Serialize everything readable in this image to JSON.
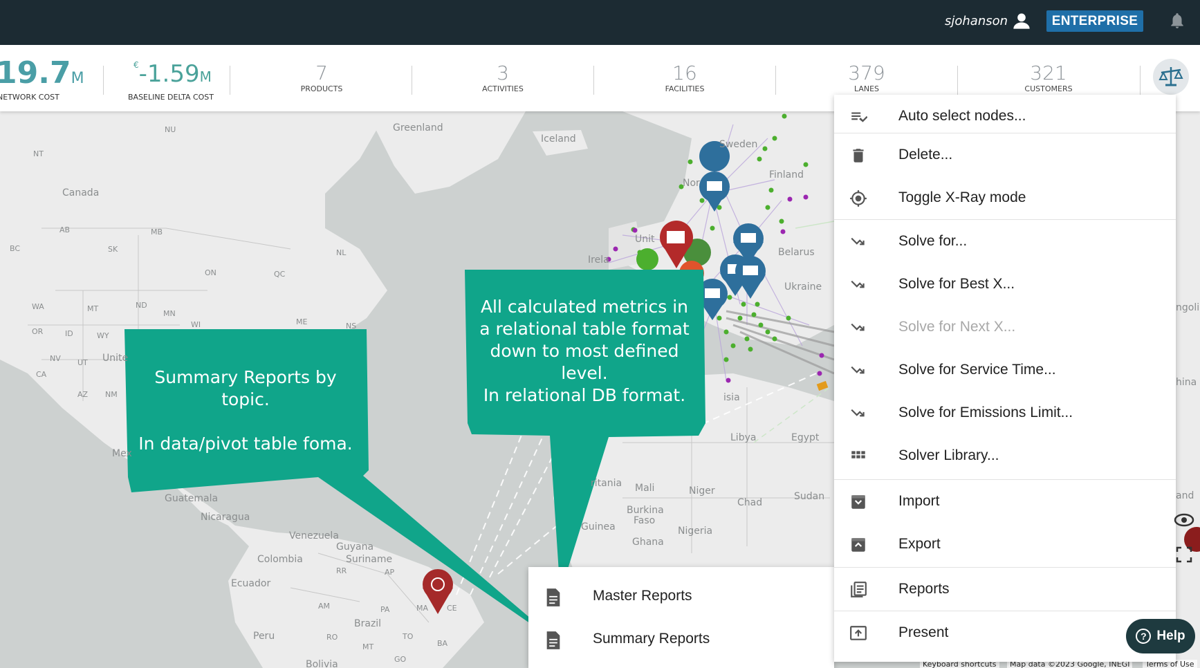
{
  "header": {
    "username": "sjohanson",
    "plan_badge": "ENTERPRISE"
  },
  "kpis": {
    "network_cost": {
      "value": "19.7",
      "unit": "M",
      "label": "NETWORK COST"
    },
    "baseline_delta": {
      "currency": "€",
      "value": "-1.59",
      "unit": "M",
      "label": "BASELINE DELTA COST"
    },
    "items": [
      {
        "value": "7",
        "label": "PRODUCTS"
      },
      {
        "value": "3",
        "label": "ACTIVITIES"
      },
      {
        "value": "16",
        "label": "FACILITIES"
      },
      {
        "value": "379",
        "label": "LANES"
      },
      {
        "value": "321",
        "label": "CUSTOMERS"
      }
    ]
  },
  "map": {
    "labels": {
      "greenland": "Greenland",
      "iceland": "Iceland",
      "sweden": "Sweden",
      "canada": "Canada",
      "nu": "NU",
      "nt": "NT",
      "ab": "AB",
      "mb": "MB",
      "bc": "BC",
      "sk": "SK",
      "nl": "NL",
      "on": "ON",
      "qc": "QC",
      "wa": "WA",
      "mt": "MT",
      "nd": "ND",
      "mn": "MN",
      "or": "OR",
      "id": "ID",
      "wy": "WY",
      "nv": "NV",
      "ut": "UT",
      "ca": "CA",
      "az": "AZ",
      "nm": "NM",
      "united": "Unite",
      "mex": "Mex",
      "guatemala": "Guatemala",
      "nicaragua": "Nicaragua",
      "venezuela": "Venezuela",
      "guyana": "Guyana",
      "suriname": "Suriname",
      "colombia": "Colombia",
      "ecuador": "Ecuador",
      "brazil": "Brazil",
      "peru": "Peru",
      "bolivia": "Bolivia",
      "am": "AM",
      "pa": "PA",
      "ma": "MA",
      "ro": "RO",
      "to": "TO",
      "ba": "BA",
      "mt2": "MT",
      "go": "GO",
      "ce": "CE",
      "rr": "RR",
      "ap": "AP",
      "libya": "Libya",
      "egypt": "Egypt",
      "mali": "Mali",
      "niger": "Niger",
      "chad": "Chad",
      "sudan": "Sudan",
      "burkina": "Burkina",
      "faso": "Faso",
      "nigeria": "Nigeria",
      "ghana": "Ghana",
      "guinea": "Guinea",
      "mauritania": "ritania",
      "belarus": "Belarus",
      "ukraine": "Ukraine",
      "finland": "Finland",
      "ireland": "Irela",
      "unit": "Unit",
      "isia": "isia",
      "ngolia": "ngolia",
      "hina": "hina",
      "and": "and",
      "nor": "Nor",
      "me": "ME",
      "ns": "NS",
      "wi": "WI"
    },
    "footer": {
      "shortcuts": "Keyboard shortcuts",
      "data": "Map data ©2023 Google, INEGI",
      "terms": "Terms of Use"
    }
  },
  "callouts": {
    "summary": "Summary Reports by\ntopic.\n\nIn data/pivot table foma.",
    "metrics": "All calculated metrics in\na relational table format\ndown to most defined\nlevel.\nIn relational DB format."
  },
  "context_menu": {
    "items": [
      {
        "label": "Auto select nodes...",
        "icon": "playlist-check-icon"
      },
      {
        "label": "Delete...",
        "icon": "trash-icon"
      },
      {
        "label": "Toggle X-Ray mode",
        "icon": "crosshair-icon"
      },
      {
        "label": "Solve for...",
        "icon": "trend-arrow-icon"
      },
      {
        "label": "Solve for Best X...",
        "icon": "trend-arrow-icon"
      },
      {
        "label": "Solve for Next X...",
        "icon": "trend-arrow-icon",
        "disabled": true
      },
      {
        "label": "Solve for Service Time...",
        "icon": "trend-arrow-icon"
      },
      {
        "label": "Solve for Emissions Limit...",
        "icon": "trend-arrow-icon"
      },
      {
        "label": "Solver Library...",
        "icon": "grid-icon"
      },
      {
        "label": "Import",
        "icon": "import-icon"
      },
      {
        "label": "Export",
        "icon": "export-icon"
      },
      {
        "label": "Reports",
        "icon": "reports-icon"
      },
      {
        "label": "Present",
        "icon": "present-icon"
      }
    ]
  },
  "reports_submenu": {
    "items": [
      {
        "label": "Master Reports",
        "icon": "document-icon"
      },
      {
        "label": "Summary Reports",
        "icon": "document-icon"
      }
    ]
  },
  "help": {
    "label": "Help"
  },
  "colors": {
    "topbar": "#1c2b33",
    "enterprise": "#1f6fa8",
    "callout": "#0fa88c",
    "kpi_accent": "#4a9ea6"
  }
}
